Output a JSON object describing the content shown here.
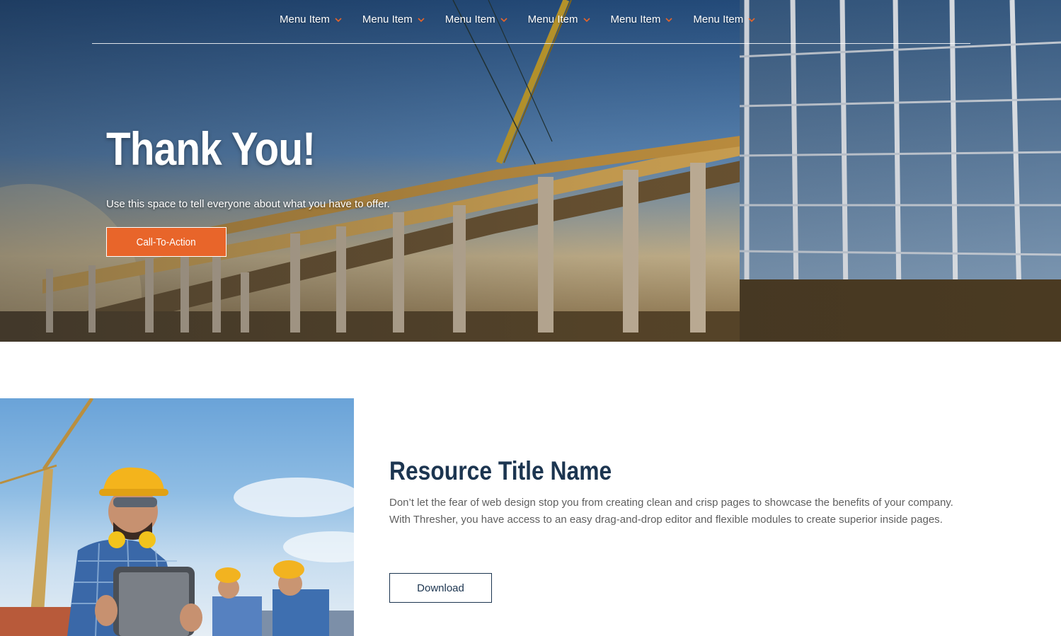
{
  "nav": {
    "items": [
      {
        "label": "Menu Item"
      },
      {
        "label": "Menu Item"
      },
      {
        "label": "Menu Item"
      },
      {
        "label": "Menu Item"
      },
      {
        "label": "Menu Item"
      },
      {
        "label": "Menu Item"
      }
    ]
  },
  "hero": {
    "title": "Thank You!",
    "subtitle": "Use this space to tell everyone about what you have to offer.",
    "cta_label": "Call-To-Action"
  },
  "resource": {
    "title": "Resource Title Name",
    "body": "Don’t let the fear of web design stop you from creating clean and crisp pages to showcase the benefits of your company. With Thresher, you have access to an easy drag-and-drop editor and flexible modules to create superior inside pages.",
    "download_label": "Download"
  },
  "colors": {
    "accent": "#e8652a",
    "heading": "#1c3550",
    "body_text": "#5f5f5f"
  }
}
